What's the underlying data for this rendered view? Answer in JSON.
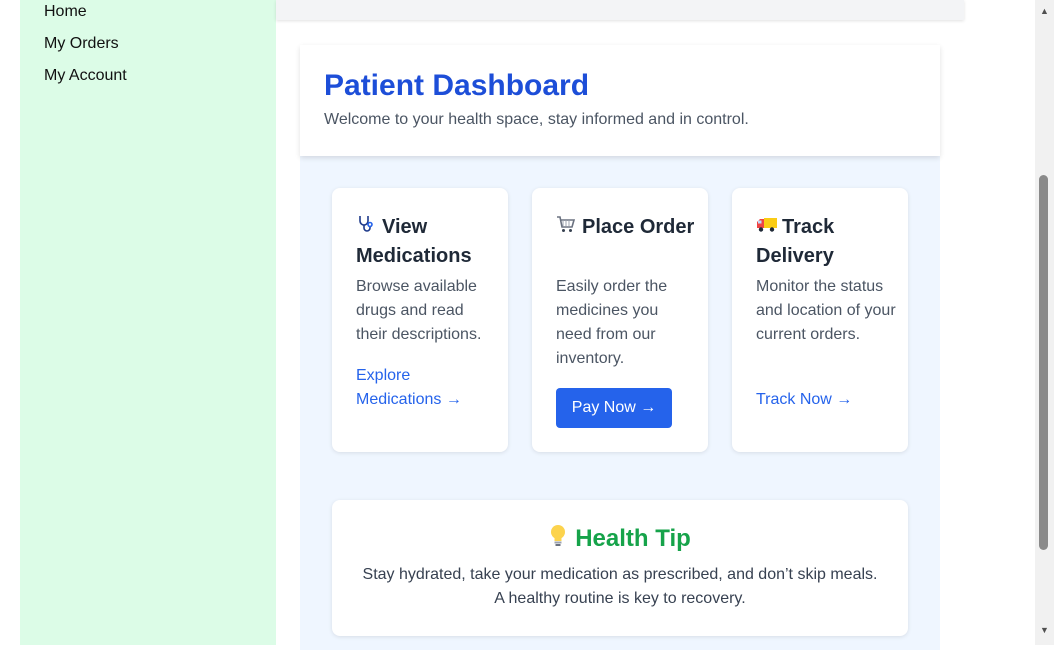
{
  "sidebar": {
    "items": [
      {
        "label": "Home"
      },
      {
        "label": "My Orders"
      },
      {
        "label": "My Account"
      }
    ]
  },
  "header": {
    "title": "Patient Dashboard",
    "subtitle": "Welcome to your health space, stay informed and in control."
  },
  "cards": [
    {
      "icon": "stethoscope-icon",
      "title": "View Medications",
      "description": "Browse available drugs and read their descriptions.",
      "action": "Explore Medications →"
    },
    {
      "icon": "shopping-cart-icon",
      "title": "Place Order",
      "description": "Easily order the medicines you need from our inventory.",
      "action": "Pay Now →"
    },
    {
      "icon": "delivery-truck-icon",
      "title": "Track Delivery",
      "description": "Monitor the status and location of your current orders.",
      "action": "Track Now →"
    }
  ],
  "health_tip": {
    "icon": "lightbulb-icon",
    "title": "Health Tip",
    "text_line1": "Stay hydrated, take your medication as prescribed, and don’t skip meals.",
    "text_line2": "A healthy routine is key to recovery."
  },
  "colors": {
    "sidebar_bg": "#dcfce7",
    "title_blue": "#1d4ed8",
    "link_blue": "#2563eb",
    "button_blue": "#2563eb",
    "tip_green": "#16a34a",
    "content_bg": "#eff6ff"
  }
}
